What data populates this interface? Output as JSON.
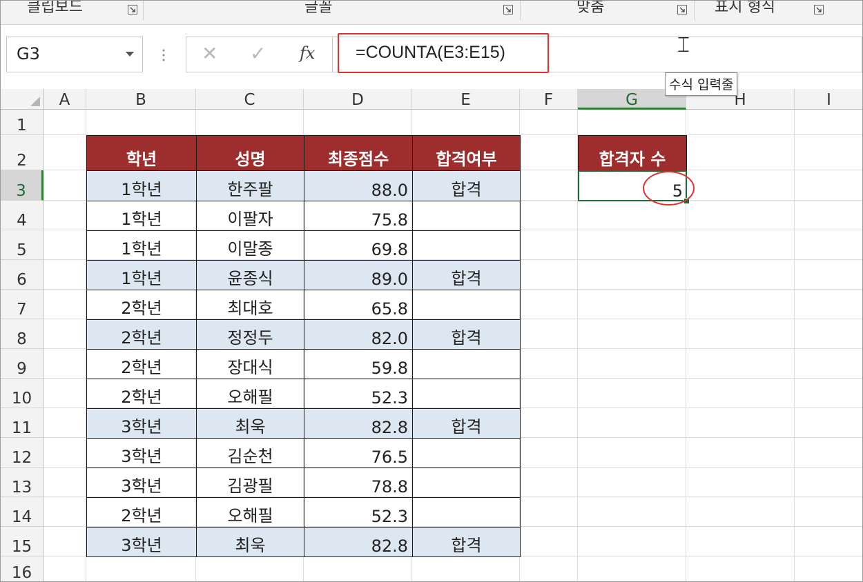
{
  "ribbon": {
    "groups": [
      {
        "label": "클립보드"
      },
      {
        "label": "글꼴"
      },
      {
        "label": "맞춤"
      },
      {
        "label": "표시 형식"
      }
    ]
  },
  "formula_bar": {
    "name_box": "G3",
    "cancel_icon": "✕",
    "enter_icon": "✓",
    "fx_label": "fx",
    "formula": "=COUNTA(E3:E15)",
    "tooltip": "수식 입력줄"
  },
  "columns": [
    "A",
    "B",
    "C",
    "D",
    "E",
    "F",
    "G",
    "H",
    "I"
  ],
  "rows": [
    "1",
    "2",
    "3",
    "4",
    "5",
    "6",
    "7",
    "8",
    "9",
    "10",
    "11",
    "12",
    "13",
    "14",
    "15",
    "16"
  ],
  "table": {
    "headers": [
      "학년",
      "성명",
      "최종점수",
      "합격여부"
    ],
    "rows": [
      {
        "grade": "1학년",
        "name": "한주팔",
        "score": "88.0",
        "pass": "합격"
      },
      {
        "grade": "1학년",
        "name": "이팔자",
        "score": "75.8",
        "pass": ""
      },
      {
        "grade": "1학년",
        "name": "이말종",
        "score": "69.8",
        "pass": ""
      },
      {
        "grade": "1학년",
        "name": "윤종식",
        "score": "89.0",
        "pass": "합격"
      },
      {
        "grade": "2학년",
        "name": "최대호",
        "score": "65.8",
        "pass": ""
      },
      {
        "grade": "2학년",
        "name": "정정두",
        "score": "82.0",
        "pass": "합격"
      },
      {
        "grade": "2학년",
        "name": "장대식",
        "score": "59.8",
        "pass": ""
      },
      {
        "grade": "2학년",
        "name": "오해필",
        "score": "52.3",
        "pass": ""
      },
      {
        "grade": "3학년",
        "name": "최욱",
        "score": "82.8",
        "pass": "합격"
      },
      {
        "grade": "3학년",
        "name": "김순천",
        "score": "76.5",
        "pass": ""
      },
      {
        "grade": "3학년",
        "name": "김광필",
        "score": "78.8",
        "pass": ""
      },
      {
        "grade": "2학년",
        "name": "오해필",
        "score": "52.3",
        "pass": ""
      },
      {
        "grade": "3학년",
        "name": "최욱",
        "score": "82.8",
        "pass": "합격"
      }
    ]
  },
  "summary": {
    "header": "합격자 수",
    "value": "5"
  },
  "colors": {
    "header_fill": "#9e2d2d",
    "shade_fill": "#dde7f2",
    "highlight": "#e03030",
    "selection": "#1f6b38"
  }
}
